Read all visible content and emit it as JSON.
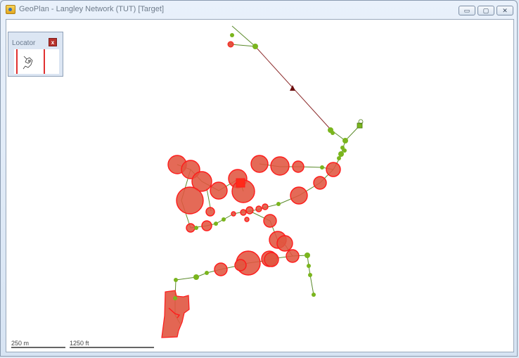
{
  "window": {
    "title": "GeoPlan - Langley Network (TUT) [Target]",
    "buttons": {
      "minimize": "▭",
      "maximize": "▢",
      "close": "✕"
    }
  },
  "locator": {
    "title": "Locator",
    "close_label": "x"
  },
  "scale_bar": {
    "metric_label": "250 m",
    "imperial_label": "1250 ft"
  },
  "colors": {
    "node": "#7ab51d",
    "flood": "#e05540",
    "flood_border": "#ff1a1a",
    "link": "#5a8a2a",
    "long_link": "#8b2a2a",
    "flow_arrow": "#6b0f0f"
  },
  "icons": {
    "app": "geoplan-app-icon",
    "flow_direction": "triangle-arrow-icon"
  }
}
